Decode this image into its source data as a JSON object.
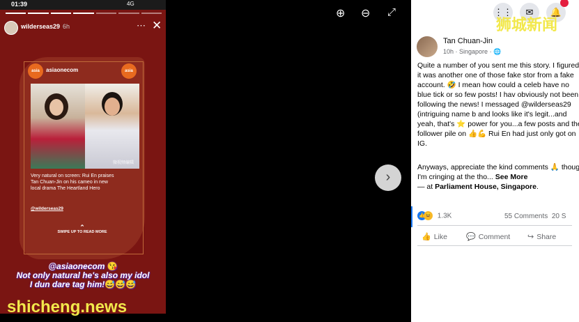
{
  "status_bar": {
    "time": "01:39",
    "network": "4G"
  },
  "story": {
    "username": "wilderseas29",
    "age": "6h",
    "more_icon": "ellipsis-icon",
    "close_icon": "close-icon",
    "publisher": "asiaonecom",
    "logo_text": "asia one",
    "photo_watermark": "微视频编辑",
    "caption": "Very natural on screen: Rui En praises Tan Chuan-Jin on his cameo in new local drama The Heartland Hero",
    "handle": "@wilderseas29",
    "swipe_label": "SWIPE UP TO READ MORE",
    "overlay_lines": [
      "@asiaonecom",
      "Not only natural he's also my idol",
      "I dun dare tag him!"
    ],
    "overlay_emojis": [
      "😘",
      "😅😅😅"
    ]
  },
  "viewer": {
    "zoom_in_icon": "zoom-in-icon",
    "zoom_out_icon": "zoom-out-icon",
    "fullscreen_icon": "fullscreen-icon",
    "next_icon": "chevron-right-icon"
  },
  "watermarks": {
    "top": "狮城新闻",
    "bottom": "shicheng.news"
  },
  "topbar": {
    "notification_count": ""
  },
  "post": {
    "author": "Tan Chuan-Jin",
    "time": "10h",
    "location": "Singapore",
    "privacy_icon": "globe-icon",
    "body": "Quite a number of you sent me this story. I figured it was another one of those fake stor from a fake account. 🤣 I mean how could a celeb have no blue tick or so few posts! I hav obviously not been following the news! I messaged @wilderseas29 (intriguing name b and looks like it's legit...and yeah, that's ⭐ power for you...a few posts and the follower pile on 👍💪 Rui En had just only got on IG.",
    "body2": "Anyways, appreciate the kind comments 🙏 though I'm cringing at the tho...",
    "see_more": "See More",
    "place_prefix": "— at ",
    "place": "Parliament House, Singapore",
    "reaction_count": "1.3K",
    "comments": "55 Comments",
    "shares": "20 S",
    "like_label": "Like",
    "comment_label": "Comment",
    "share_label": "Share"
  }
}
